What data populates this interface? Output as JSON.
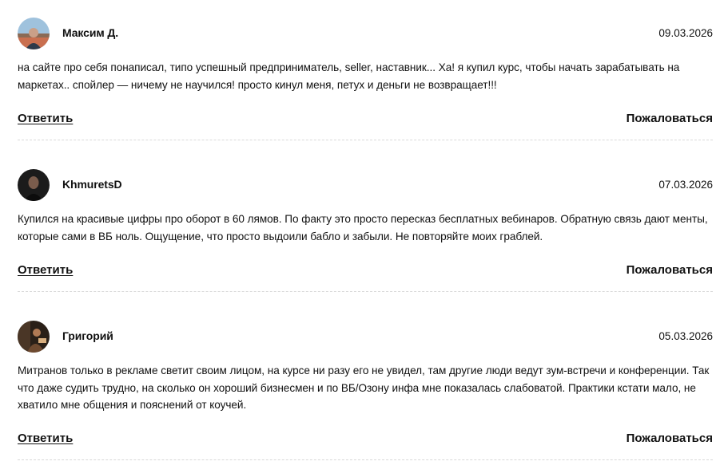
{
  "comments": [
    {
      "author": "Максим Д.",
      "date": "09.03.2026",
      "text": "на сайте про себя понаписал, типо успешный предприниматель, seller, наставник... Ха! я купил курс, чтобы начать зарабатывать на маркетах.. спойлер — ничему не научился! просто кинул меня, петух и деньги не возвращает!!!",
      "reply_label": "Ответить",
      "report_label": "Пожаловаться"
    },
    {
      "author": "KhmuretsD",
      "date": "07.03.2026",
      "text": "Купился на красивые цифры про оборот в 60 лямов. По факту это просто пересказ бесплатных вебинаров. Обратную связь дают менты, которые сами в ВБ ноль. Ощущение, что просто выдоили бабло и забыли. Не повторяйте моих граблей.",
      "reply_label": "Ответить",
      "report_label": "Пожаловаться"
    },
    {
      "author": "Григорий",
      "date": "05.03.2026",
      "text": "Митранов только в рекламе светит своим лицом, на курсе ни разу его не увидел, там другие люди ведут зум-встречи и конференции. Так что даже судить трудно, на сколько он хороший бизнесмен и по ВБ/Озону инфа мне показалась слабоватой. Практики кстати мало, не хватило мне общения и пояснений от коучей.",
      "reply_label": "Ответить",
      "report_label": "Пожаловаться"
    }
  ]
}
